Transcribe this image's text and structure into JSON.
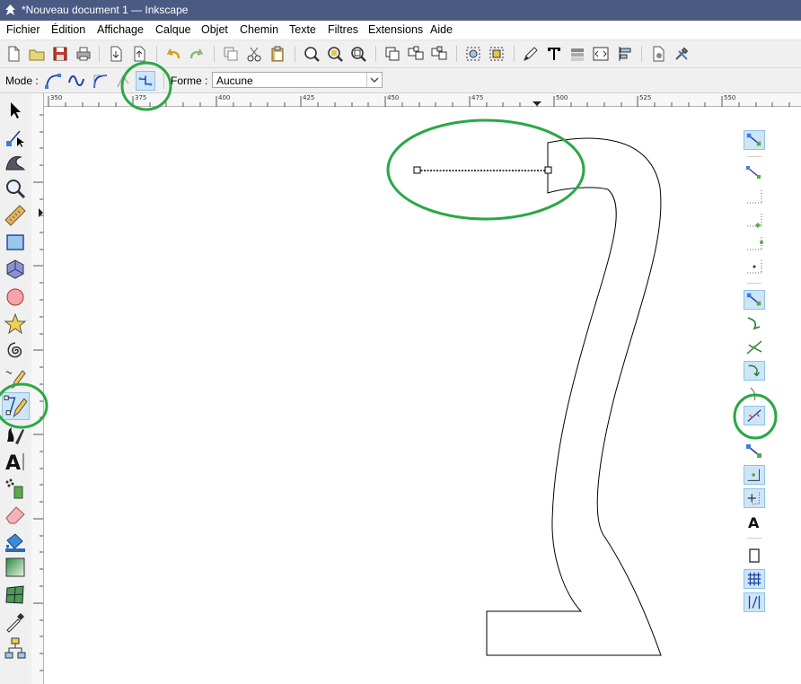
{
  "window": {
    "title": "*Nouveau document 1 — Inkscape"
  },
  "menu": [
    "Fichier",
    "Édition",
    "Affichage",
    "Calque",
    "Objet",
    "Chemin",
    "Texte",
    "Filtres",
    "Extensions",
    "Aide"
  ],
  "controls": {
    "mode_label": "Mode :",
    "forme_label": "Forme :",
    "forme_value": "Aucune"
  },
  "ruler": {
    "h_ticks": [
      "350",
      "375",
      "400",
      "425",
      "450",
      "475",
      "500",
      "525",
      "550"
    ]
  },
  "colors": {
    "titlebar": "#4a5a82",
    "active_bg": "#cde6f7",
    "highlight_ellipse": "#2aa845"
  }
}
